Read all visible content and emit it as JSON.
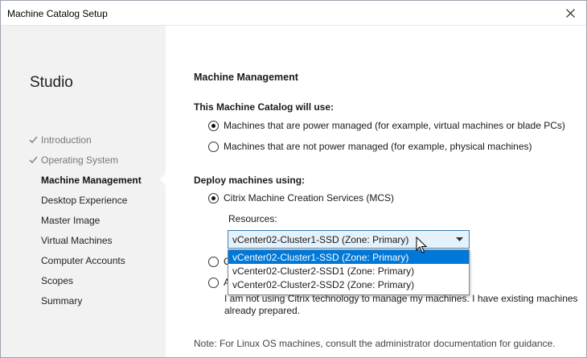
{
  "window": {
    "title": "Machine Catalog Setup"
  },
  "sidebar": {
    "brand": "Studio",
    "items": [
      {
        "label": "Introduction",
        "state": "done"
      },
      {
        "label": "Operating System",
        "state": "done"
      },
      {
        "label": "Machine Management",
        "state": "active"
      },
      {
        "label": "Desktop Experience",
        "state": "pending"
      },
      {
        "label": "Master Image",
        "state": "pending"
      },
      {
        "label": "Virtual Machines",
        "state": "pending"
      },
      {
        "label": "Computer Accounts",
        "state": "pending"
      },
      {
        "label": "Scopes",
        "state": "pending"
      },
      {
        "label": "Summary",
        "state": "pending"
      }
    ]
  },
  "main": {
    "heading": "Machine Management",
    "catalog_section": {
      "label": "This Machine Catalog will use:",
      "options": [
        {
          "label": "Machines that are power managed (for example, virtual machines or blade PCs)",
          "checked": true
        },
        {
          "label": "Machines that are not power managed (for example, physical machines)",
          "checked": false
        }
      ]
    },
    "deploy_section": {
      "label": "Deploy machines using:",
      "mcs_option": {
        "label": "Citrix Machine Creation Services (MCS)",
        "checked": true
      },
      "resources_label": "Resources:",
      "resources_selected": "vCenter02-Cluster1-SSD (Zone: Primary)",
      "resources_options": [
        "vCenter02-Cluster1-SSD (Zone: Primary)",
        "vCenter02-Cluster2-SSD1 (Zone: Primary)",
        "vCenter02-Cluster2-SSD2 (Zone: Primary)"
      ],
      "other_option_1": {
        "visible_label": "C",
        "checked": false
      },
      "other_option_2": {
        "visible_label": "A",
        "checked": false
      },
      "existing_text": "I am not using Citrix technology to manage my machines. I have existing machines already prepared."
    },
    "note": "Note: For Linux OS machines, consult the administrator documentation for guidance."
  },
  "colors": {
    "selection": "#0078d7",
    "combo_border": "#3c7fb1",
    "combo_bg": "#e5f1fb",
    "sidebar_bg": "#f2f2f2"
  }
}
